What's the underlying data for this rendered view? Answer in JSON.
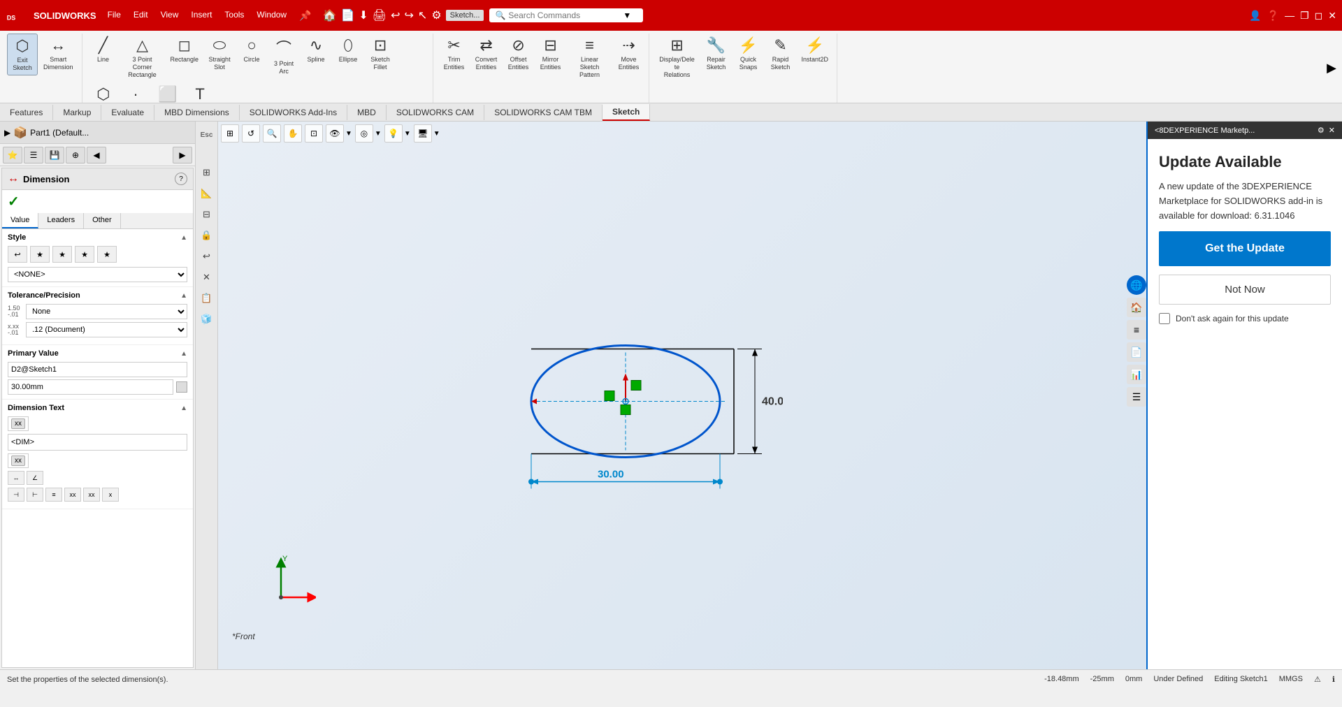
{
  "titlebar": {
    "logo_text": "SOLIDWORKS",
    "menus": [
      "File",
      "Edit",
      "View",
      "Insert",
      "Tools",
      "Window"
    ],
    "search_placeholder": "Search Commands",
    "window_controls": [
      "—",
      "❐",
      "✕"
    ]
  },
  "ribbon": {
    "groups": [
      {
        "items": [
          {
            "icon": "⬡",
            "label": "Exit\nSketch"
          },
          {
            "icon": "↔",
            "label": "Smart\nDimension"
          }
        ]
      },
      {
        "items": [
          {
            "icon": "╱",
            "label": "Line"
          },
          {
            "icon": "△",
            "label": "3 Point Corner\nRectangle"
          },
          {
            "icon": "◻",
            "label": "Rectangle"
          },
          {
            "icon": "◯",
            "label": "Straight\nSlot"
          },
          {
            "icon": "○",
            "label": "Circle"
          },
          {
            "icon": "⌒",
            "label": "3 Point\nArc"
          },
          {
            "icon": "~",
            "label": "Spline"
          },
          {
            "icon": "⬯",
            "label": "Ellipse"
          },
          {
            "icon": "⊡",
            "label": "Sketch\nFillet"
          },
          {
            "icon": "⬡",
            "label": "Polygon"
          },
          {
            "icon": "·",
            "label": "Point"
          },
          {
            "icon": "░",
            "label": "Plane"
          },
          {
            "icon": "T",
            "label": "Text"
          }
        ]
      },
      {
        "items": [
          {
            "icon": "✂",
            "label": "Trim\nEntities"
          },
          {
            "icon": "⇄",
            "label": "Convert\nEntities"
          },
          {
            "icon": "⊘",
            "label": "Offset\nEntities"
          },
          {
            "icon": "⊟",
            "label": "Mirror\nEntities"
          },
          {
            "icon": "≡",
            "label": "Linear Sketch\nPattern"
          },
          {
            "icon": "⇢",
            "label": "Move\nEntities"
          }
        ]
      },
      {
        "items": [
          {
            "icon": "⊞",
            "label": "Display/Delete\nRelations"
          },
          {
            "icon": "🔧",
            "label": "Repair\nSketch"
          },
          {
            "icon": "⚡",
            "label": "Quick\nSnaps"
          },
          {
            "icon": "✎",
            "label": "Rapid\nSketch"
          },
          {
            "icon": "⚡",
            "label": "Instant2D"
          }
        ]
      }
    ],
    "tabs": [
      "Features",
      "Markup",
      "Evaluate",
      "MBD Dimensions",
      "SOLIDWORKS Add-Ins",
      "MBD",
      "SOLIDWORKS CAM",
      "SOLIDWORKS CAM TBM",
      "Sketch"
    ],
    "active_tab": "Sketch"
  },
  "left_panel": {
    "prop_icons": [
      "⭐",
      "☰",
      "💾",
      "⊕",
      "◀"
    ],
    "dimension": {
      "title": "Dimension",
      "help_icon": "?",
      "confirm_icon": "✓",
      "tabs": [
        "Value",
        "Leaders",
        "Other"
      ],
      "active_tab": "Value",
      "style_section": {
        "label": "Style",
        "icons": [
          "↩",
          "★",
          "★",
          "★",
          "★"
        ],
        "dropdown_value": "<NONE>"
      },
      "tolerance_section": {
        "label": "Tolerance/Precision",
        "tolerance_value": "None",
        "precision_value": ".12 (Document)"
      },
      "primary_value_section": {
        "label": "Primary Value",
        "sketch_ref": "D2@Sketch1",
        "value": "30.00mm"
      },
      "dimension_text_section": {
        "label": "Dimension Text",
        "tag1": "xx",
        "text1": "<DIM>",
        "tag2": "xx"
      }
    }
  },
  "canvas": {
    "dimension_h": "40.00",
    "dimension_v": "30.00",
    "view_label": "*Front",
    "coord_labels": [
      "Y",
      "X"
    ]
  },
  "update_panel": {
    "panel_title": "<8DEXPERIENCE Marketp...",
    "title": "Update Available",
    "description": "A new update of the 3DEXPERIENCE Marketplace for SOLIDWORKS add-in is available for download: 6.31.1046",
    "btn_get_update": "Get the Update",
    "btn_not_now": "Not Now",
    "dont_ask_label": "Don't ask again for this update"
  },
  "statusbar": {
    "message": "Set the properties of the selected dimension(s).",
    "x_coord": "-18.48mm",
    "y_coord": "-25mm",
    "z_coord": "0mm",
    "state": "Under Defined",
    "editing": "Editing Sketch1",
    "units": "MMGS"
  }
}
